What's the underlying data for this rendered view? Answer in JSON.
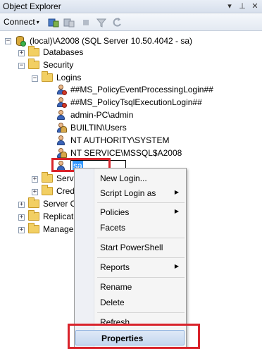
{
  "window": {
    "title": "Object Explorer",
    "pin_glyph": "▾",
    "autohide_glyph": "⊥",
    "close_glyph": "✕"
  },
  "toolbar": {
    "connect_label": "Connect",
    "connect_arrow": "▾",
    "icons": [
      "connect-object-explorer-icon",
      "disconnect-icon",
      "stop-icon",
      "filter-icon",
      "refresh-icon"
    ]
  },
  "tree": {
    "server": "(local)\\A2008 (SQL Server 10.50.4042 - sa)",
    "databases": "Databases",
    "security": "Security",
    "logins": "Logins",
    "login_items": [
      "##MS_PolicyEventProcessingLogin##",
      "##MS_PolicyTsqlExecutionLogin##",
      "admin-PC\\admin",
      "BUILTIN\\Users",
      "NT AUTHORITY\\SYSTEM",
      "NT SERVICE\\MSSQL$A2008",
      "sa"
    ],
    "server_roles_partial": "Serve",
    "credentials_partial": "Cred",
    "server_objects_partial": "Server O",
    "replication_partial": "Replicat",
    "management_partial": "Manage",
    "expand_glyph": "+",
    "collapse_glyph": "−"
  },
  "context_menu": {
    "items": [
      {
        "label": "New Login...",
        "submenu": false
      },
      {
        "label": "Script Login as",
        "submenu": true
      },
      {
        "label": "Policies",
        "submenu": true
      },
      {
        "label": "Facets",
        "submenu": false
      },
      {
        "label": "Start PowerShell",
        "submenu": false
      },
      {
        "label": "Reports",
        "submenu": true
      },
      {
        "label": "Rename",
        "submenu": false
      },
      {
        "label": "Delete",
        "submenu": false
      },
      {
        "label": "Refresh",
        "submenu": false
      },
      {
        "label": "Properties",
        "submenu": false
      }
    ],
    "submenu_glyph": "▶",
    "highlighted": "Properties"
  },
  "colors": {
    "annotation_red": "#d9232b",
    "selection_blue": "#3399ff"
  }
}
